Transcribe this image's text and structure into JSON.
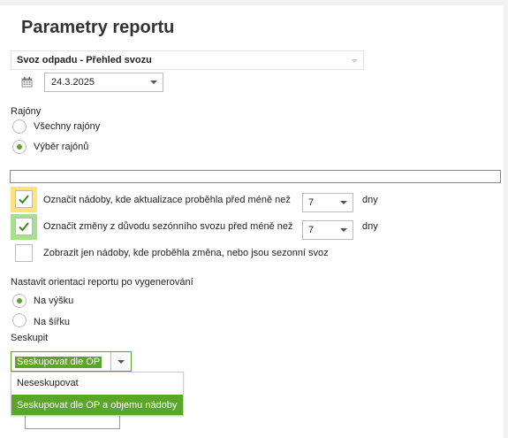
{
  "page": {
    "title": "Parametry reportu"
  },
  "report_select": {
    "value": "Svoz odpadu - Přehled svozu"
  },
  "date": {
    "value": "24.3.2025"
  },
  "districts": {
    "heading": "Rajóny",
    "options": [
      {
        "label": "Všechny rajóny",
        "selected": false
      },
      {
        "label": "Výběr rajónů",
        "selected": true
      }
    ]
  },
  "checks": [
    {
      "label": "Označit nádoby, kde aktualizace proběhla před méně než",
      "checked": true,
      "highlight": "#ffe27a",
      "value": "7",
      "unit": "dny"
    },
    {
      "label": "Označit změny z důvodu sezónního svozu před méně než",
      "checked": true,
      "highlight": "#a6e08f",
      "value": "7",
      "unit": "dny"
    },
    {
      "label": "Zobrazit jen nádoby, kde proběhla změna, nebo jsou sezonní svoz",
      "checked": false
    }
  ],
  "orientation": {
    "heading": "Nastavit orientaci reportu po vygenerování",
    "options": [
      {
        "label": "Na výšku",
        "selected": true
      },
      {
        "label": "Na šířku",
        "selected": false
      }
    ]
  },
  "grouping": {
    "heading": "Seskupit",
    "value": "Seskupovat dle OP",
    "options": [
      {
        "label": "Neseskupovat",
        "active": false
      },
      {
        "label": "Seskupovat dle OP a objemu nádoby",
        "active": true
      }
    ]
  },
  "colors": {
    "accent": "#5aa52a",
    "check": "#3a8a1a"
  }
}
